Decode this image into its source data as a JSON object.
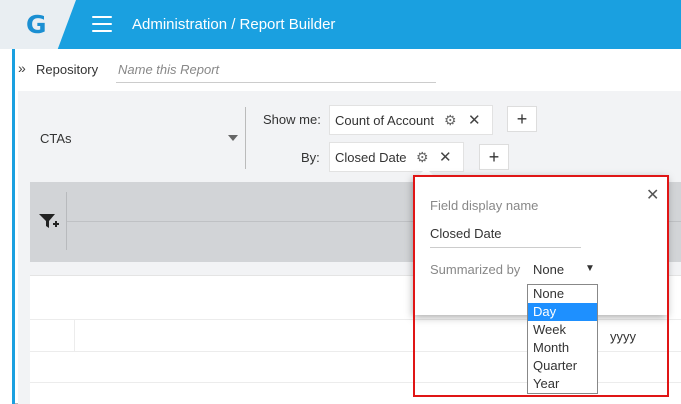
{
  "header": {
    "logo_letter": "G",
    "title": "Administration / Report Builder",
    "accent_color": "#1aa0e0"
  },
  "subbar": {
    "repository_label": "Repository",
    "report_name_placeholder": "Name this Report",
    "report_name_value": ""
  },
  "builder": {
    "source": "CTAs",
    "show_me_label": "Show me:",
    "show_me_field": "Count of Account",
    "by_label": "By:",
    "by_field": "Closed Date"
  },
  "table": {
    "cell_value": "yyyy"
  },
  "popover": {
    "field_display_name_label": "Field display name",
    "field_display_name_value": "Closed Date",
    "summarized_by_label": "Summarized by",
    "summarized_by_value": "None",
    "options": [
      "None",
      "Day",
      "Week",
      "Month",
      "Quarter",
      "Year"
    ],
    "highlighted_option": "Day"
  },
  "icons": {
    "menu": "hamburger-icon",
    "expand": "double-chevron-right-icon",
    "gear": "gear-icon",
    "close": "close-icon",
    "add": "plus-icon",
    "filter": "filter-add-icon",
    "caret": "caret-down-icon"
  },
  "colors": {
    "highlight_border": "#e01515",
    "selected_option": "#1e90ff"
  }
}
